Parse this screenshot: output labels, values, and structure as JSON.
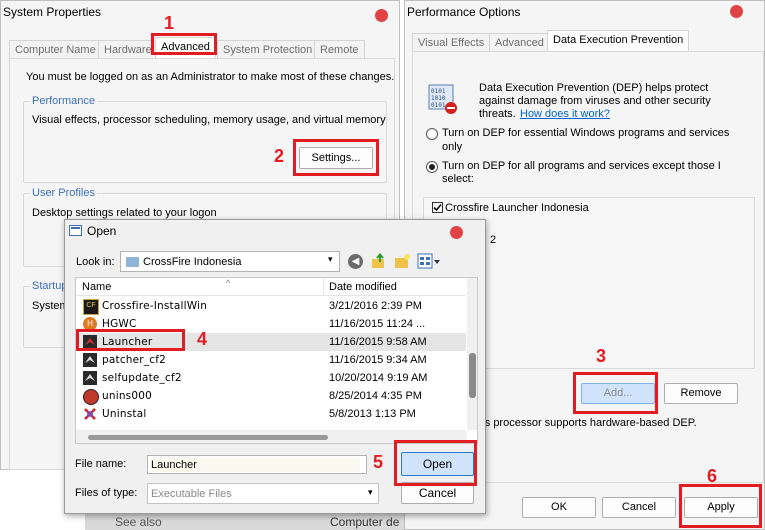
{
  "system_properties": {
    "title": "System Properties",
    "tabs": [
      "Computer Name",
      "Hardware",
      "Advanced",
      "System Protection",
      "Remote"
    ],
    "admin_note": "You must be logged on as an Administrator to make most of these changes.",
    "performance": {
      "label": "Performance",
      "description": "Visual effects, processor scheduling, memory usage, and virtual memory",
      "settings_button": "Settings..."
    },
    "user_profiles": {
      "label": "User Profiles",
      "description": "Desktop settings related to your logon"
    },
    "startup": {
      "label": "Startup",
      "description": "System"
    }
  },
  "performance_options": {
    "title": "Performance Options",
    "tabs": [
      "Visual Effects",
      "Advanced",
      "Data Execution Prevention"
    ],
    "dep_text_1": "Data Execution Prevention (DEP) helps protect",
    "dep_text_2": "against damage from viruses and other security",
    "dep_text_3": "threats.",
    "dep_link": "How does it work?",
    "radio_1_line1": "Turn on DEP for essential Windows programs and services",
    "radio_1_line2": "only",
    "radio_2_line1": "Turn on DEP for all programs and services except those I",
    "radio_2_line2": "select:",
    "list_items": [
      "Crossfire Launcher Indonesia",
      "2"
    ],
    "add_button": "Add...",
    "remove_button": "Remove",
    "processor_note": "r's processor supports hardware-based DEP.",
    "ok_button": "OK",
    "cancel_button": "Cancel",
    "apply_button": "Apply"
  },
  "open_dialog": {
    "title": "Open",
    "look_in_label": "Look in:",
    "look_in_value": "CrossFire Indonesia",
    "col_name": "Name",
    "col_date": "Date modified",
    "files": [
      {
        "name": "Crossfire-InstallWin",
        "date": "3/21/2016 2:39 PM"
      },
      {
        "name": "HGWC",
        "date": "11/16/2015 11:24 ..."
      },
      {
        "name": "Launcher",
        "date": "11/16/2015 9:58 AM"
      },
      {
        "name": "patcher_cf2",
        "date": "11/16/2015 9:34 AM"
      },
      {
        "name": "selfupdate_cf2",
        "date": "10/20/2014 9:19 AM"
      },
      {
        "name": "unins000",
        "date": "8/25/2014 4:35 PM"
      },
      {
        "name": "Uninstal",
        "date": "5/8/2013 1:13 PM"
      }
    ],
    "file_name_label": "File name:",
    "file_name_value": "Launcher",
    "files_of_type_label": "Files of type:",
    "files_of_type_value": "Executable Files",
    "open_button": "Open",
    "cancel_button": "Cancel"
  },
  "background": {
    "see_also": "See also",
    "computer": "Computer de"
  },
  "steps": [
    "1",
    "2",
    "3",
    "4",
    "5",
    "6"
  ],
  "colors": {
    "annotation_red": "#e31b23",
    "link_blue": "#0066cc",
    "group_label_blue": "#3c6fbb"
  }
}
